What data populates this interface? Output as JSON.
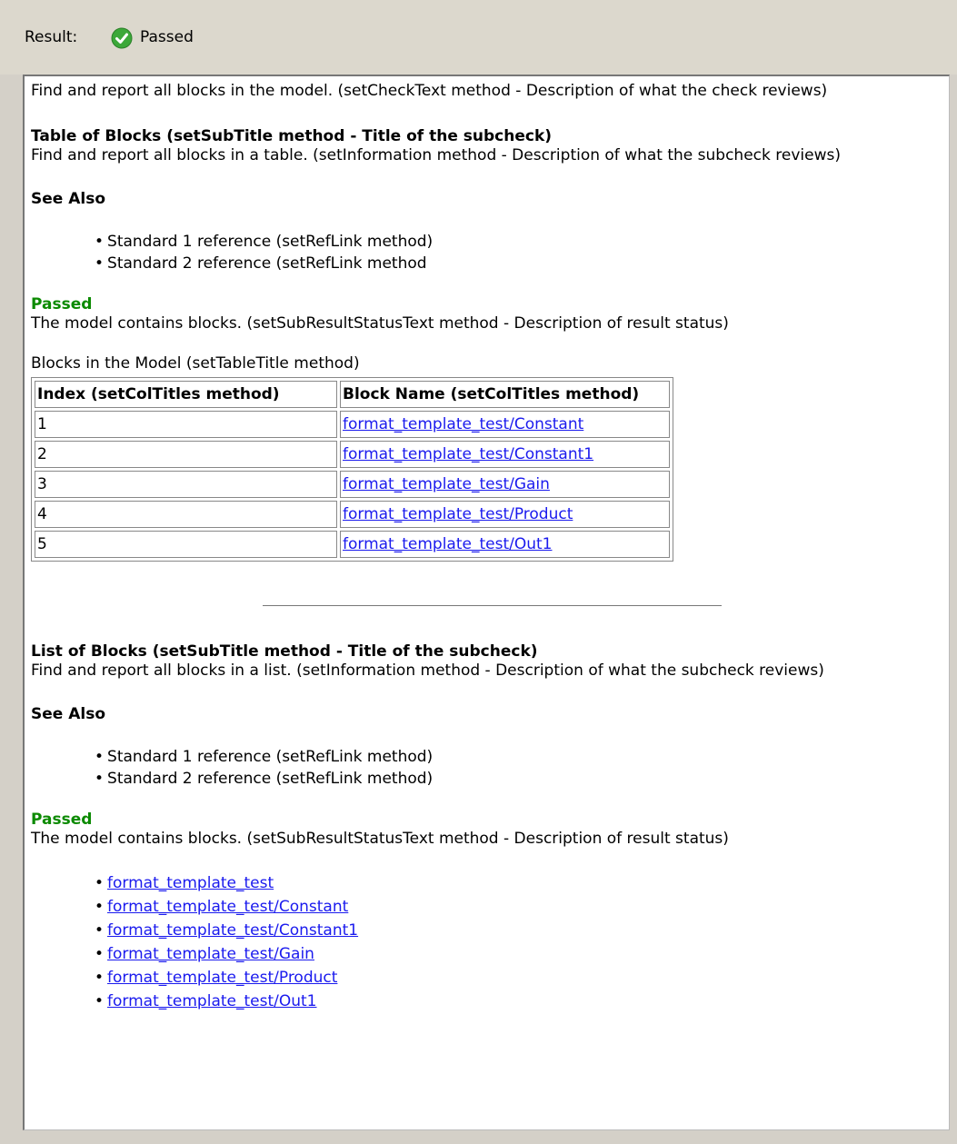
{
  "result": {
    "label": "Result:",
    "status": "Passed",
    "status_color": "#3ca839"
  },
  "report": {
    "check_text": "Find and report all blocks in the model. (setCheckText method - Description of what the check reviews)",
    "section1": {
      "subtitle": "Table of Blocks (setSubTitle method - Title of the subcheck)",
      "information": "Find and report all blocks in a table. (setInformation method - Description of what the subcheck reviews)",
      "see_also": "See Also",
      "refs": [
        "Standard 1 reference (setRefLink method)",
        "Standard 2 reference (setRefLink method"
      ],
      "status": "Passed",
      "status_text": "The model contains blocks. (setSubResultStatusText method - Description of result status)",
      "table_title": "Blocks in the Model (setTableTitle method)",
      "col_titles": [
        "Index (setColTitles method)",
        "Block Name (setColTitles method)"
      ],
      "rows": [
        {
          "index": "1",
          "name": "format_template_test/Constant"
        },
        {
          "index": "2",
          "name": "format_template_test/Constant1"
        },
        {
          "index": "3",
          "name": "format_template_test/Gain"
        },
        {
          "index": "4",
          "name": "format_template_test/Product"
        },
        {
          "index": "5",
          "name": "format_template_test/Out1"
        }
      ]
    },
    "section2": {
      "subtitle": "List of Blocks (setSubTitle method - Title of the subcheck)",
      "information": "Find and report all blocks in a list. (setInformation method - Description of what the subcheck reviews)",
      "see_also": "See Also",
      "refs": [
        "Standard 1 reference (setRefLink method)",
        "Standard 2 reference (setRefLink method)"
      ],
      "status": "Passed",
      "status_text": "The model contains blocks. (setSubResultStatusText method - Description of result status)",
      "links": [
        "format_template_test",
        "format_template_test/Constant",
        "format_template_test/Constant1",
        "format_template_test/Gain",
        "format_template_test/Product",
        "format_template_test/Out1"
      ]
    }
  }
}
